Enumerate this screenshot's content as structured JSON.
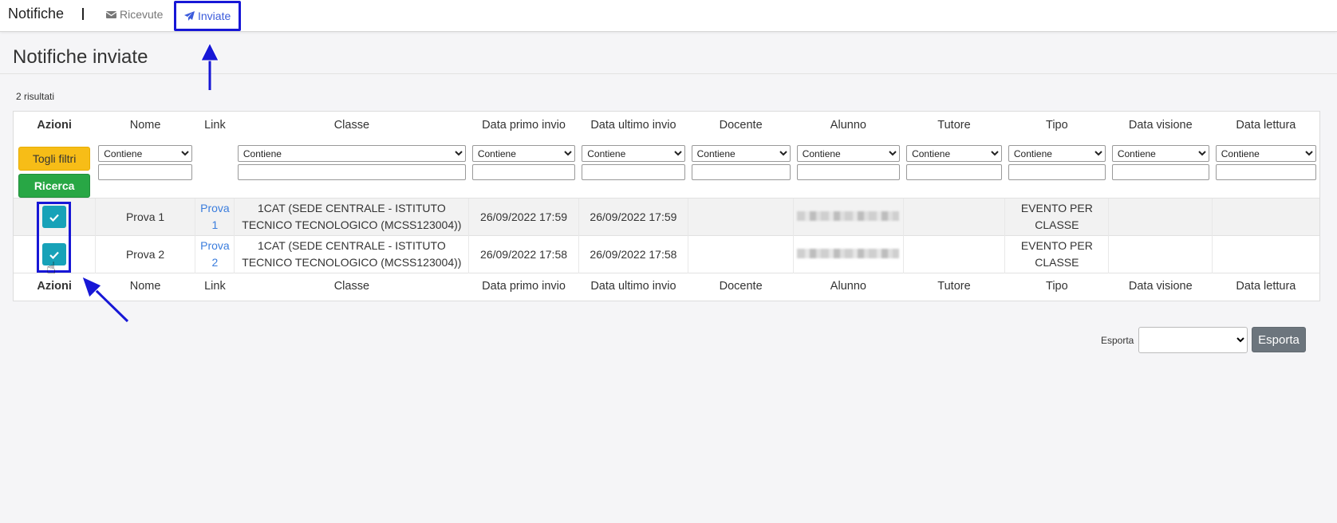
{
  "header": {
    "brand": "Notifiche",
    "nav": {
      "received_label": "Ricevute",
      "sent_label": "Inviate"
    }
  },
  "page": {
    "title": "Notifiche inviate",
    "result_count": "2 risultati"
  },
  "table": {
    "columns": [
      "Azioni",
      "Nome",
      "Link",
      "Classe",
      "Data primo invio",
      "Data ultimo invio",
      "Docente",
      "Alunno",
      "Tutore",
      "Tipo",
      "Data visione",
      "Data lettura"
    ],
    "filter_option": "Contiene",
    "buttons": {
      "clear_filters": "Togli filtri",
      "search": "Ricerca"
    },
    "rows": [
      {
        "nome": "Prova 1",
        "link": "Prova 1",
        "classe": "1CAT (SEDE CENTRALE - ISTITUTO TECNICO TECNOLOGICO (MCSS123004))",
        "data_primo_invio": "26/09/2022 17:59",
        "data_ultimo_invio": "26/09/2022 17:59",
        "docente": "",
        "tutore": "",
        "tipo": "EVENTO PER CLASSE",
        "data_visione": "",
        "data_lettura": ""
      },
      {
        "nome": "Prova 2",
        "link": "Prova 2",
        "classe": "1CAT (SEDE CENTRALE - ISTITUTO TECNICO TECNOLOGICO (MCSS123004))",
        "data_primo_invio": "26/09/2022 17:58",
        "data_ultimo_invio": "26/09/2022 17:58",
        "docente": "",
        "tutore": "",
        "tipo": "EVENTO PER CLASSE",
        "data_visione": "",
        "data_lettura": ""
      }
    ]
  },
  "export": {
    "label": "Esporta",
    "button_label": "Esporta"
  },
  "icons": {
    "received": "envelope-icon",
    "sent": "paper-plane-icon",
    "row_action": "check-icon",
    "pointer": "hand-pointer-icon"
  },
  "colors": {
    "annotation": "#1717d6",
    "clear_filters": "#f7bd17",
    "search": "#28a745",
    "check_button": "#17a2b8",
    "link": "#3b7ddd",
    "export_button": "#6c757d"
  }
}
